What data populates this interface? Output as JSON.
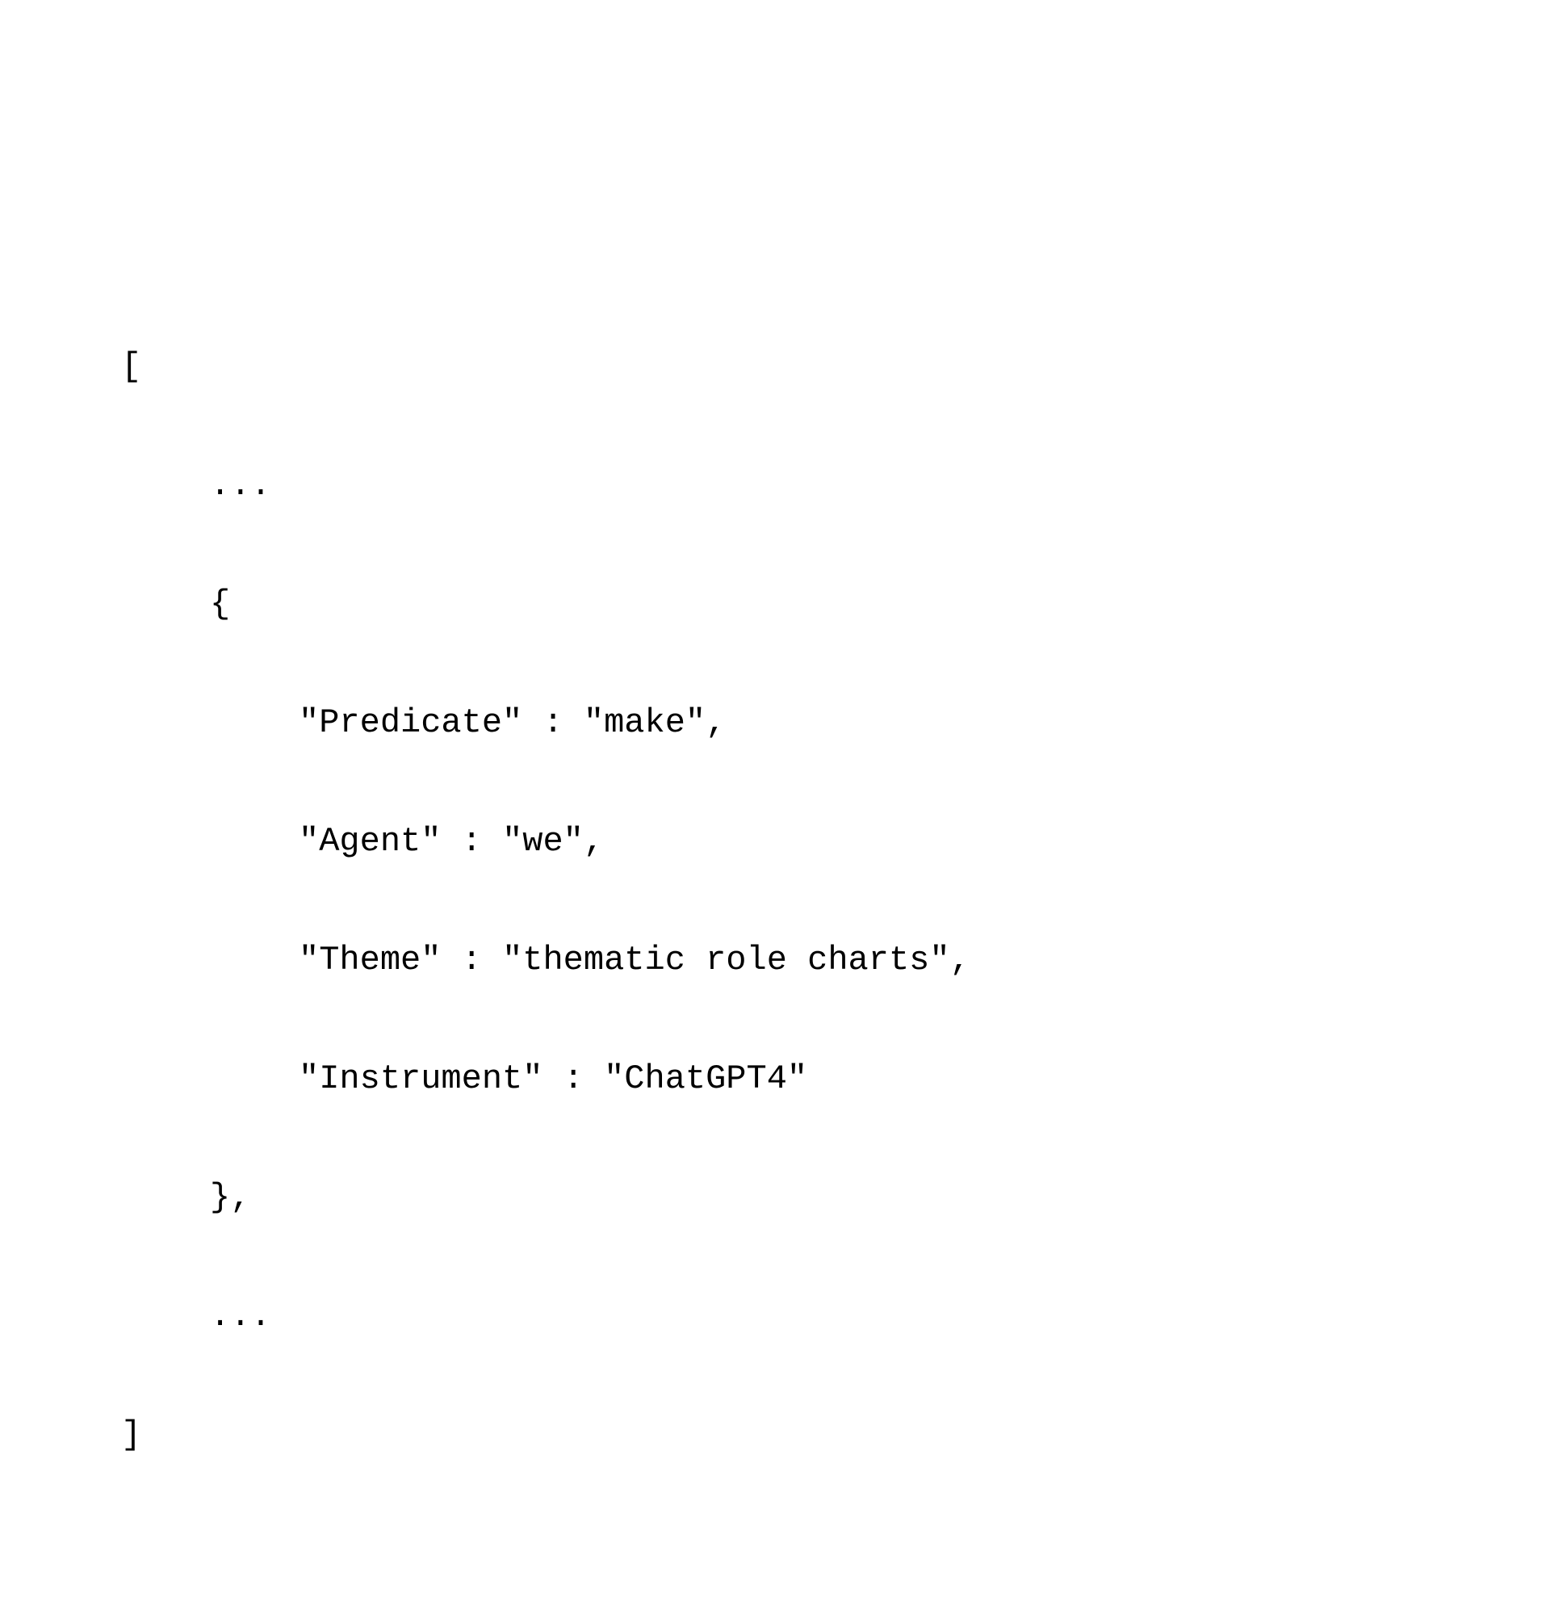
{
  "code": {
    "open_bracket": "[",
    "ellipsis_top": "...",
    "open_brace": "{",
    "pairs": [
      {
        "key": "\"Predicate\"",
        "value": "\"make\"",
        "comma": ","
      },
      {
        "key": "\"Agent\"",
        "value": "\"we\"",
        "comma": ","
      },
      {
        "key": "\"Theme\"",
        "value": "\"thematic role charts\"",
        "comma": ","
      },
      {
        "key": "\"Instrument\"",
        "value": "\"ChatGPT4\"",
        "comma": ""
      }
    ],
    "close_brace": "},",
    "ellipsis_bottom": "...",
    "close_bracket": "]"
  }
}
